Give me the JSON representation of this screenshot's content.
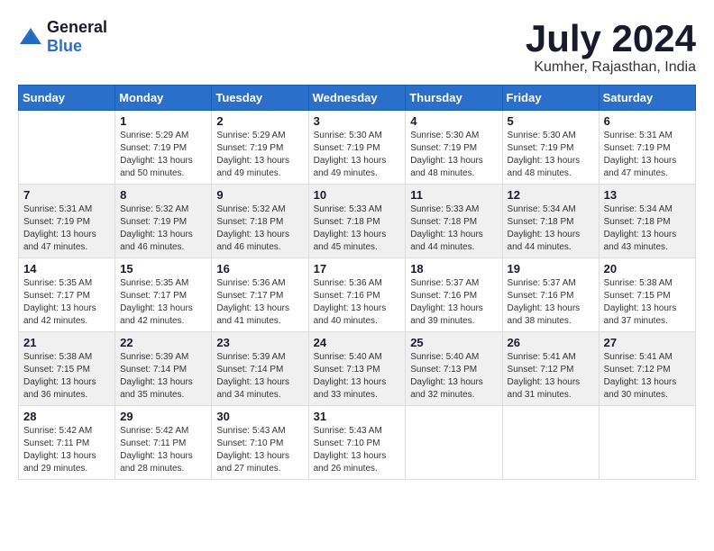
{
  "header": {
    "logo_general": "General",
    "logo_blue": "Blue",
    "month": "July 2024",
    "location": "Kumher, Rajasthan, India"
  },
  "days_of_week": [
    "Sunday",
    "Monday",
    "Tuesday",
    "Wednesday",
    "Thursday",
    "Friday",
    "Saturday"
  ],
  "weeks": [
    [
      {
        "day": "",
        "info": ""
      },
      {
        "day": "1",
        "info": "Sunrise: 5:29 AM\nSunset: 7:19 PM\nDaylight: 13 hours\nand 50 minutes."
      },
      {
        "day": "2",
        "info": "Sunrise: 5:29 AM\nSunset: 7:19 PM\nDaylight: 13 hours\nand 49 minutes."
      },
      {
        "day": "3",
        "info": "Sunrise: 5:30 AM\nSunset: 7:19 PM\nDaylight: 13 hours\nand 49 minutes."
      },
      {
        "day": "4",
        "info": "Sunrise: 5:30 AM\nSunset: 7:19 PM\nDaylight: 13 hours\nand 48 minutes."
      },
      {
        "day": "5",
        "info": "Sunrise: 5:30 AM\nSunset: 7:19 PM\nDaylight: 13 hours\nand 48 minutes."
      },
      {
        "day": "6",
        "info": "Sunrise: 5:31 AM\nSunset: 7:19 PM\nDaylight: 13 hours\nand 47 minutes."
      }
    ],
    [
      {
        "day": "7",
        "info": "Sunrise: 5:31 AM\nSunset: 7:19 PM\nDaylight: 13 hours\nand 47 minutes."
      },
      {
        "day": "8",
        "info": "Sunrise: 5:32 AM\nSunset: 7:19 PM\nDaylight: 13 hours\nand 46 minutes."
      },
      {
        "day": "9",
        "info": "Sunrise: 5:32 AM\nSunset: 7:18 PM\nDaylight: 13 hours\nand 46 minutes."
      },
      {
        "day": "10",
        "info": "Sunrise: 5:33 AM\nSunset: 7:18 PM\nDaylight: 13 hours\nand 45 minutes."
      },
      {
        "day": "11",
        "info": "Sunrise: 5:33 AM\nSunset: 7:18 PM\nDaylight: 13 hours\nand 44 minutes."
      },
      {
        "day": "12",
        "info": "Sunrise: 5:34 AM\nSunset: 7:18 PM\nDaylight: 13 hours\nand 44 minutes."
      },
      {
        "day": "13",
        "info": "Sunrise: 5:34 AM\nSunset: 7:18 PM\nDaylight: 13 hours\nand 43 minutes."
      }
    ],
    [
      {
        "day": "14",
        "info": "Sunrise: 5:35 AM\nSunset: 7:17 PM\nDaylight: 13 hours\nand 42 minutes."
      },
      {
        "day": "15",
        "info": "Sunrise: 5:35 AM\nSunset: 7:17 PM\nDaylight: 13 hours\nand 42 minutes."
      },
      {
        "day": "16",
        "info": "Sunrise: 5:36 AM\nSunset: 7:17 PM\nDaylight: 13 hours\nand 41 minutes."
      },
      {
        "day": "17",
        "info": "Sunrise: 5:36 AM\nSunset: 7:16 PM\nDaylight: 13 hours\nand 40 minutes."
      },
      {
        "day": "18",
        "info": "Sunrise: 5:37 AM\nSunset: 7:16 PM\nDaylight: 13 hours\nand 39 minutes."
      },
      {
        "day": "19",
        "info": "Sunrise: 5:37 AM\nSunset: 7:16 PM\nDaylight: 13 hours\nand 38 minutes."
      },
      {
        "day": "20",
        "info": "Sunrise: 5:38 AM\nSunset: 7:15 PM\nDaylight: 13 hours\nand 37 minutes."
      }
    ],
    [
      {
        "day": "21",
        "info": "Sunrise: 5:38 AM\nSunset: 7:15 PM\nDaylight: 13 hours\nand 36 minutes."
      },
      {
        "day": "22",
        "info": "Sunrise: 5:39 AM\nSunset: 7:14 PM\nDaylight: 13 hours\nand 35 minutes."
      },
      {
        "day": "23",
        "info": "Sunrise: 5:39 AM\nSunset: 7:14 PM\nDaylight: 13 hours\nand 34 minutes."
      },
      {
        "day": "24",
        "info": "Sunrise: 5:40 AM\nSunset: 7:13 PM\nDaylight: 13 hours\nand 33 minutes."
      },
      {
        "day": "25",
        "info": "Sunrise: 5:40 AM\nSunset: 7:13 PM\nDaylight: 13 hours\nand 32 minutes."
      },
      {
        "day": "26",
        "info": "Sunrise: 5:41 AM\nSunset: 7:12 PM\nDaylight: 13 hours\nand 31 minutes."
      },
      {
        "day": "27",
        "info": "Sunrise: 5:41 AM\nSunset: 7:12 PM\nDaylight: 13 hours\nand 30 minutes."
      }
    ],
    [
      {
        "day": "28",
        "info": "Sunrise: 5:42 AM\nSunset: 7:11 PM\nDaylight: 13 hours\nand 29 minutes."
      },
      {
        "day": "29",
        "info": "Sunrise: 5:42 AM\nSunset: 7:11 PM\nDaylight: 13 hours\nand 28 minutes."
      },
      {
        "day": "30",
        "info": "Sunrise: 5:43 AM\nSunset: 7:10 PM\nDaylight: 13 hours\nand 27 minutes."
      },
      {
        "day": "31",
        "info": "Sunrise: 5:43 AM\nSunset: 7:10 PM\nDaylight: 13 hours\nand 26 minutes."
      },
      {
        "day": "",
        "info": ""
      },
      {
        "day": "",
        "info": ""
      },
      {
        "day": "",
        "info": ""
      }
    ]
  ]
}
